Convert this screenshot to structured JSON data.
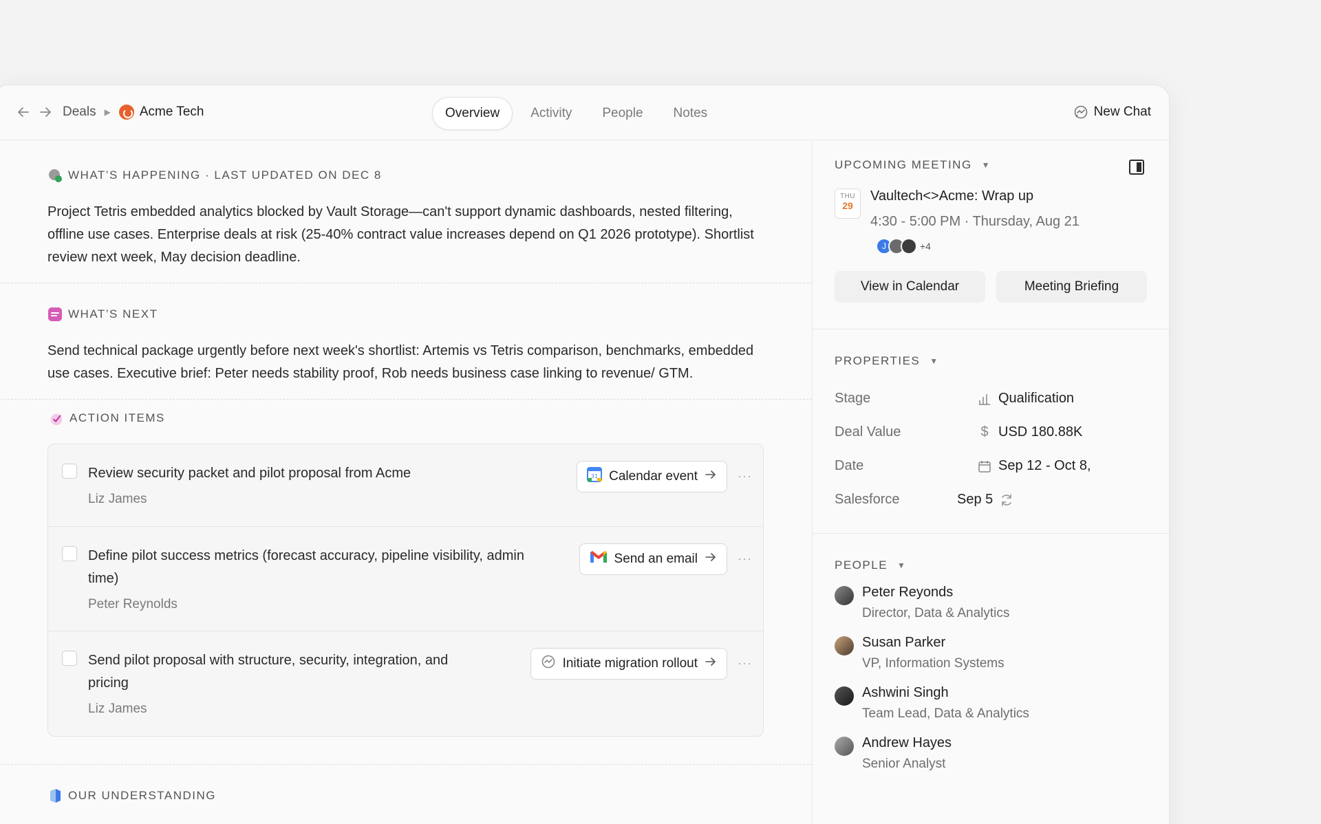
{
  "header": {
    "breadcrumb": {
      "root": "Deals",
      "company": "Acme Tech"
    },
    "tabs": [
      "Overview",
      "Activity",
      "People",
      "Notes"
    ],
    "active_tab": "Overview",
    "new_chat_label": "New Chat"
  },
  "happening": {
    "title": "WHAT’S HAPPENING · LAST UPDATED ON DEC 8",
    "body": "Project Tetris embedded analytics blocked by Vault Storage—can't support dynamic dashboards, nested filtering, offline use cases. Enterprise deals at risk (25-40% contract value increases depend on Q1 2026 prototype). Shortlist review next week, May decision deadline."
  },
  "next": {
    "title": "WHAT’S NEXT",
    "body": "Send technical package urgently before next week's shortlist: Artemis vs Tetris comparison, benchmarks, embedded use cases. Executive brief: Peter needs stability proof, Rob needs business case linking to revenue/ GTM."
  },
  "actions": {
    "title": "ACTION ITEMS",
    "items": [
      {
        "title": "Review security packet and pilot proposal from Acme",
        "owner": "Liz James",
        "button": "Calendar event",
        "icon": "google-calendar-icon"
      },
      {
        "title": "Define pilot success metrics (forecast accuracy, pipeline visibility, admin time)",
        "owner": "Peter Reynolds",
        "button": "Send an email",
        "icon": "gmail-icon"
      },
      {
        "title": "Send pilot proposal with structure, security, integration, and pricing",
        "owner": "Liz James",
        "button": "Initiate migration rollout",
        "icon": "chat-icon"
      }
    ]
  },
  "understanding": {
    "title": "OUR UNDERSTANDING"
  },
  "meeting": {
    "header": "UPCOMING MEETING",
    "dow": "THU",
    "day": "29",
    "title": "Vaultech<>Acme: Wrap up",
    "time": "4:30 - 5:00 PM · Thursday, Aug 21",
    "attendee_initial": "J",
    "attendees_more": "+4",
    "btn_calendar": "View in Calendar",
    "btn_briefing": "Meeting Briefing"
  },
  "properties": {
    "header": "PROPERTIES",
    "items": [
      {
        "key": "Stage",
        "value": "Qualification",
        "icon": "bar-chart-icon"
      },
      {
        "key": "Deal Value",
        "value": "USD 180.88K",
        "icon": "dollar-icon"
      },
      {
        "key": "Date",
        "value": "Sep 12 - Oct 8,",
        "icon": "calendar-icon"
      },
      {
        "key": "Salesforce",
        "value": "Sep 5",
        "icon": "refresh-icon"
      }
    ]
  },
  "people": {
    "header": "PEOPLE",
    "items": [
      {
        "name": "Peter Reyonds",
        "role": "Director, Data & Analytics"
      },
      {
        "name": "Susan Parker",
        "role": "VP, Information Systems"
      },
      {
        "name": "Ashwini Singh",
        "role": "Team Lead, Data & Analytics"
      },
      {
        "name": "Andrew Hayes",
        "role": "Senior Analyst"
      }
    ]
  }
}
